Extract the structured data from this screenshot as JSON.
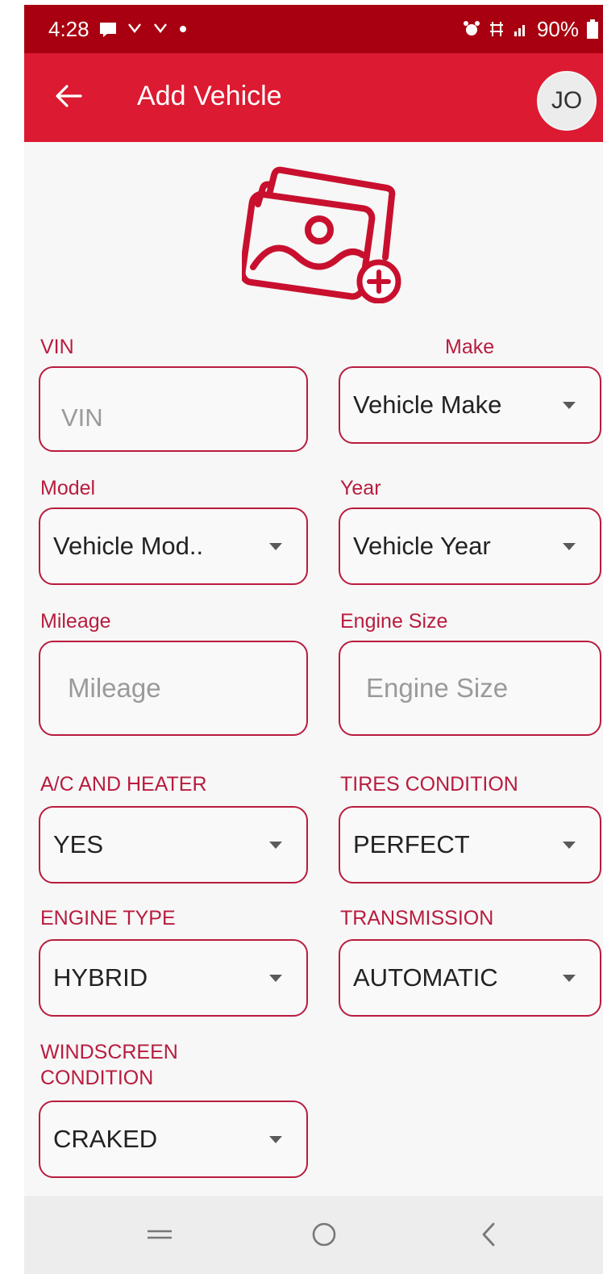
{
  "status_bar": {
    "time": "4:28",
    "battery": "90%"
  },
  "app_bar": {
    "title": "Add Vehicle",
    "avatar_initials": "JO"
  },
  "form": {
    "vin": {
      "label": "VIN",
      "placeholder": "VIN"
    },
    "make": {
      "label": "Make",
      "value": "Vehicle Make"
    },
    "model": {
      "label": "Model",
      "value": "Vehicle Mod.."
    },
    "year": {
      "label": "Year",
      "value": "Vehicle Year"
    },
    "mileage": {
      "label": "Mileage",
      "placeholder": "Mileage"
    },
    "engine_size": {
      "label": "Engine Size",
      "placeholder": "Engine Size"
    },
    "ac_heater": {
      "label": "A/C AND HEATER",
      "value": "YES"
    },
    "tires_condition": {
      "label": "TIRES CONDITION",
      "value": "PERFECT"
    },
    "engine_type": {
      "label": "ENGINE TYPE",
      "value": "HYBRID"
    },
    "transmission": {
      "label": "TRANSMISSION",
      "value": "AUTOMATIC"
    },
    "windscreen_condition": {
      "label_line1": "WINDSCREEN",
      "label_line2": "CONDITION",
      "value": "CRAKED"
    }
  },
  "icons": {
    "photo": "image-add-icon",
    "back": "arrow-left-icon",
    "dropdown": "caret-down-icon"
  },
  "colors": {
    "status_bar": "#a80010",
    "app_bar": "#dc1a31",
    "accent": "#b81c3e",
    "background": "#f7f7f7"
  }
}
